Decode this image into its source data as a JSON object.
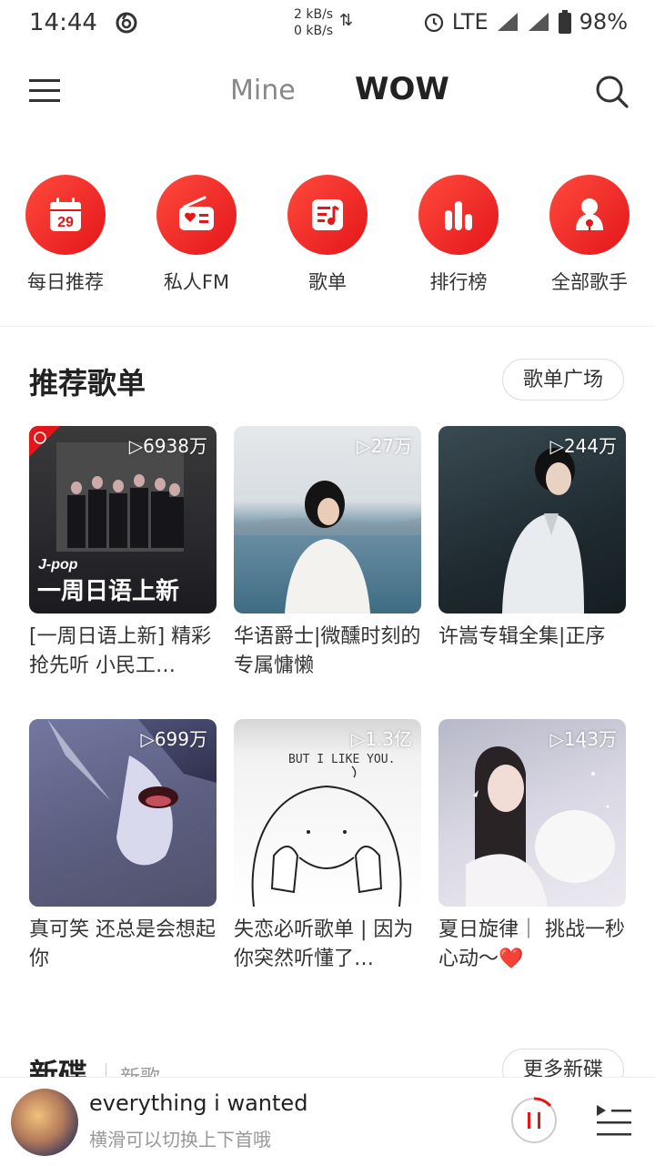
{
  "status_bar": {
    "time": "14:44",
    "speed_up": "2 kB/s",
    "speed_down": "0 kB/s",
    "network": "LTE",
    "battery": "98%"
  },
  "nav": {
    "tab_mine": "Mine",
    "tab_wow": "WOW"
  },
  "quick_actions": [
    {
      "label": "每日推荐",
      "icon": "calendar-icon",
      "date": "29"
    },
    {
      "label": "私人FM",
      "icon": "radio-icon"
    },
    {
      "label": "歌单",
      "icon": "playlist-icon"
    },
    {
      "label": "排行榜",
      "icon": "chart-icon"
    },
    {
      "label": "全部歌手",
      "icon": "singer-icon"
    }
  ],
  "recommended": {
    "title": "推荐歌单",
    "more_button": "歌单广场",
    "playlists": [
      {
        "plays": "▷6938万",
        "title": "[一周日语上新] 精彩抢先听 小民工…",
        "cover_tag": "J-pop",
        "cover_text": "一周日语上新"
      },
      {
        "plays": "▷27万",
        "title": "华语爵士|微醺时刻的专属慵懒"
      },
      {
        "plays": "▷244万",
        "title": "许嵩专辑全集|正序"
      },
      {
        "plays": "▷699万",
        "title": "真可笑 还总是会想起你"
      },
      {
        "plays": "▷1.3亿",
        "title": "失恋必听歌单 | 因为你突然听懂了…",
        "cover_text": "BUT I LIKE YOU."
      },
      {
        "plays": "▷143万",
        "title": "夏日旋律｜ 挑战一秒心动～❤️"
      }
    ]
  },
  "new_section": {
    "title": "新碟",
    "subtitle": "新歌",
    "more_button": "更多新碟"
  },
  "player": {
    "song": "everything i wanted",
    "hint": "横滑可以切换上下首哦"
  },
  "colors": {
    "accent": "#e3161a",
    "accent_light": "#ff4a3d"
  }
}
